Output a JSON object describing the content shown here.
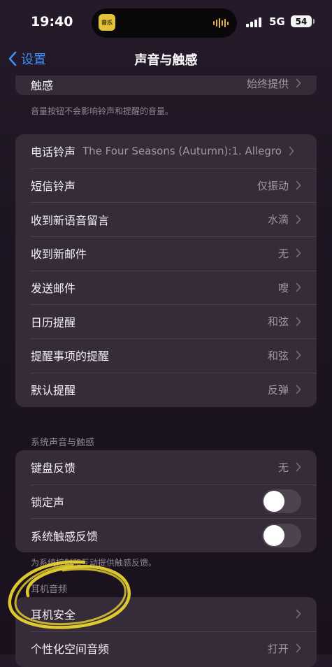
{
  "status_bar": {
    "time": "19:40",
    "island_app_label": "音乐",
    "network": "5G",
    "battery": "54"
  },
  "nav": {
    "back_label": "设置",
    "title": "声音与触感"
  },
  "top_row": {
    "label": "触感",
    "value": "始终提供"
  },
  "volume_note": "音量按钮不会影响铃声和提醒的音量。",
  "sounds": [
    {
      "label": "电话铃声",
      "value": "The Four Seasons (Autumn):1. Allegro"
    },
    {
      "label": "短信铃声",
      "value": "仅振动"
    },
    {
      "label": "收到新语音留言",
      "value": "水滴"
    },
    {
      "label": "收到新邮件",
      "value": "无"
    },
    {
      "label": "发送邮件",
      "value": "嗖"
    },
    {
      "label": "日历提醒",
      "value": "和弦"
    },
    {
      "label": "提醒事项的提醒",
      "value": "和弦"
    },
    {
      "label": "默认提醒",
      "value": "反弹"
    }
  ],
  "system_section": {
    "header": "系统声音与触感",
    "keyboard": {
      "label": "键盘反馈",
      "value": "无"
    },
    "lock_sound": {
      "label": "锁定声",
      "on": false
    },
    "system_haptics": {
      "label": "系统触感反馈",
      "on": false
    },
    "footnote": "为系统控制和互动提供触感反馈。"
  },
  "headphone_section": {
    "header": "耳机音频",
    "safety": {
      "label": "耳机安全"
    },
    "spatial": {
      "label": "个性化空间音频",
      "value": "打开"
    }
  },
  "colors": {
    "accent": "#3d8ff5",
    "cell_bg": "#362b38",
    "highlight_scribble": "#e8d230"
  }
}
